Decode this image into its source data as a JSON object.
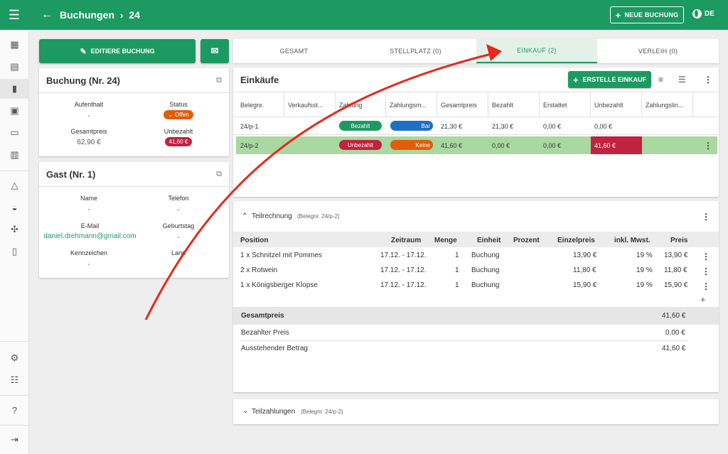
{
  "header": {
    "title": "Buchungen",
    "booking_id": "24",
    "new_booking": "NEUE BUCHUNG",
    "lang": "DE"
  },
  "actions": {
    "edit_booking": "EDITIERE BUCHUNG"
  },
  "booking_card": {
    "title": "Buchung (Nr. 24)",
    "stay_label": "Aufenthalt",
    "stay_value": "-",
    "status_label": "Status",
    "status_value": "Offen",
    "total_label": "Gesamtpreis",
    "total_value": "62,90 €",
    "unpaid_label": "Unbezahlt",
    "unpaid_value": "41,60 €"
  },
  "guest_card": {
    "title": "Gast (Nr. 1)",
    "name_label": "Name",
    "name_value": "-",
    "phone_label": "Telefon",
    "phone_value": "-",
    "email_label": "E-Mail",
    "email_value": "daniel.drehmann@gmail.com",
    "birthday_label": "Geburtstag",
    "birthday_value": "-",
    "plate_label": "Kennzeichen",
    "plate_value": "-",
    "country_label": "Land"
  },
  "tabs": [
    "GESAMT",
    "STELLPLATZ (0)",
    "EINKAUF (2)",
    "VERLEIH (0)"
  ],
  "purchases": {
    "title": "Einkäufe",
    "create_button": "ERSTELLE EINKAUF",
    "columns": [
      "Belegnr.",
      "Verkaufsst...",
      "Zahlung",
      "Zahlungsm...",
      "Gesamtpreis",
      "Bezahlt",
      "Erstattet",
      "Unbezahlt",
      "Zahlungslin..."
    ],
    "rows": [
      {
        "id": "24/p-1",
        "payment": "Bezahlt",
        "method": "Bar",
        "total": "21,30 €",
        "paid": "21,30 €",
        "refunded": "0,00 €",
        "unpaid": "0,00 €"
      },
      {
        "id": "24/p-2",
        "payment": "Unbezahlt",
        "method": "Keine",
        "total": "41,60 €",
        "paid": "0,00 €",
        "refunded": "0,00 €",
        "unpaid": "41,60 €"
      }
    ]
  },
  "partial_invoice": {
    "title": "Teilrechnung",
    "ref": "(Belegnr. 24/p-2)",
    "columns": [
      "Position",
      "Zeitraum",
      "Menge",
      "Einheit",
      "Prozent",
      "Einzelpreis",
      "inkl. Mwst.",
      "Preis"
    ],
    "rows": [
      {
        "position": "1 x Schnitzel mit Pommes",
        "period": "17.12. - 17.12.",
        "qty": "1",
        "unit": "Buchung",
        "unit_price": "13,90 €",
        "vat": "19 %",
        "price": "13,90 €"
      },
      {
        "position": "2 x Rotwein",
        "period": "17.12. - 17.12.",
        "qty": "1",
        "unit": "Buchung",
        "unit_price": "11,80 €",
        "vat": "19 %",
        "price": "11,80 €"
      },
      {
        "position": "1 x Königsberger Klopse",
        "period": "17.12. - 17.12.",
        "qty": "1",
        "unit": "Buchung",
        "unit_price": "15,90 €",
        "vat": "19 %",
        "price": "15,90 €"
      }
    ],
    "total_label": "Gesamtpreis",
    "total_value": "41,60 €",
    "paid_label": "Bezahlter Preis",
    "paid_value": "0,00 €",
    "due_label": "Ausstehender Betrag",
    "due_value": "41,60 €"
  },
  "partial_payments": {
    "title": "Teilzahlungen",
    "ref": "(Belegnr. 24/p-2)"
  },
  "colors": {
    "primary": "#1c9a62",
    "danger": "#c0223f",
    "warning": "#e05d0a",
    "info": "#1e6fc4",
    "highlight_row": "#a9d8a0"
  }
}
